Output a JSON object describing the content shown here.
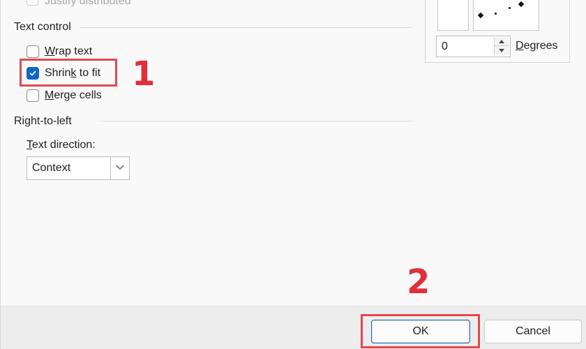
{
  "dialog": {
    "alignment": {
      "justify_distributed_label": "Justify distributed",
      "justify_distributed_checked": false
    },
    "text_control": {
      "title": "Text control",
      "options": [
        {
          "label": "Wrap text",
          "checked": false
        },
        {
          "label": "Shrink to fit",
          "checked": true
        },
        {
          "label": "Merge cells",
          "checked": false
        }
      ]
    },
    "right_to_left": {
      "title": "Right-to-left",
      "text_direction_label": "Text direction:",
      "text_direction_value": "Context"
    },
    "orientation": {
      "degrees_value": "0",
      "degrees_label": "Degrees"
    },
    "buttons": {
      "ok_label": "OK",
      "cancel_label": "Cancel"
    },
    "annotations": {
      "step_1": "1",
      "step_2": "2"
    }
  }
}
